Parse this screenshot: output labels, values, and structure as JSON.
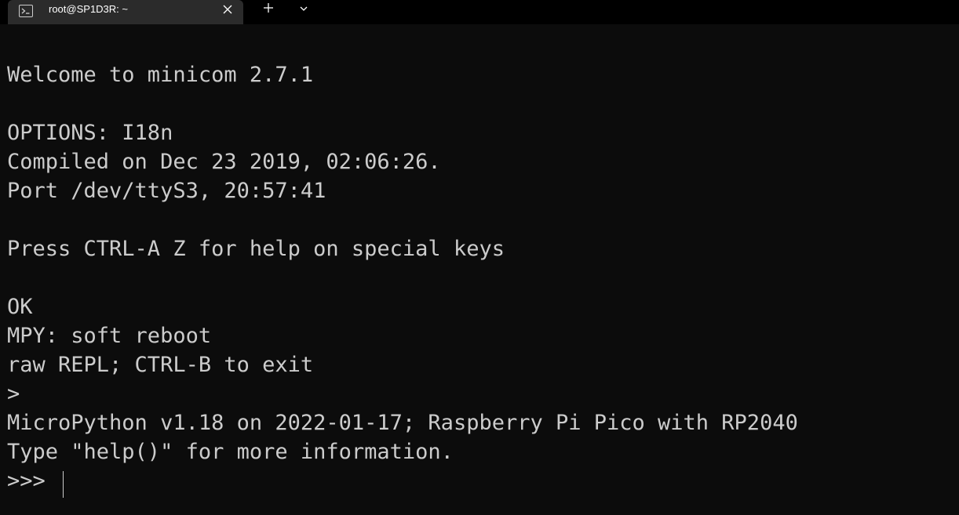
{
  "window": {
    "tab_title": "root@SP1D3R: ~",
    "close_icon": "close-icon",
    "new_tab_icon": "plus-icon",
    "dropdown_icon": "chevron-down-icon",
    "terminal_icon": "terminal-icon"
  },
  "terminal": {
    "lines": [
      "Welcome to minicom 2.7.1",
      "",
      "OPTIONS: I18n",
      "Compiled on Dec 23 2019, 02:06:26.",
      "Port /dev/ttyS3, 20:57:41",
      "",
      "Press CTRL-A Z for help on special keys",
      "",
      "OK",
      "MPY: soft reboot",
      "raw REPL; CTRL-B to exit",
      ">",
      "MicroPython v1.18 on 2022-01-17; Raspberry Pi Pico with RP2040",
      "Type \"help()\" for more information.",
      ">>> "
    ]
  },
  "colors": {
    "background": "#0c0c0c",
    "foreground": "#cccccc",
    "tab_active": "#2b2b2b"
  }
}
